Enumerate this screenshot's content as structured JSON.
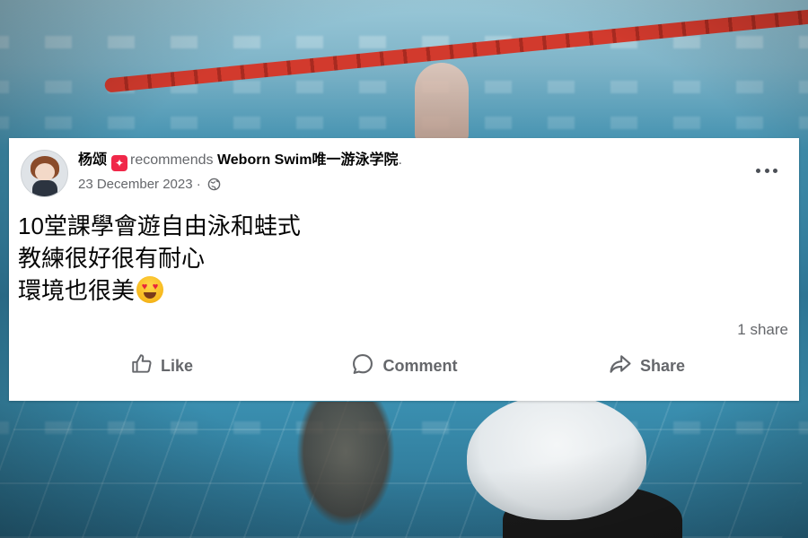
{
  "post": {
    "author": "杨颂",
    "recommend_verb": "recommends",
    "page_name": "Weborn Swim唯一游泳学院",
    "page_name_suffix": ".",
    "date": "23 December 2023",
    "separator": "·",
    "visibility_icon": "globe-icon",
    "text_lines": [
      "10堂課學會遊自由泳和蛙式",
      "教練很好很有耐心",
      "環境也很美"
    ],
    "emoji": "heart-eyes-emoji",
    "share_count": "1 share"
  },
  "actions": {
    "like_label": "Like",
    "comment_label": "Comment",
    "share_label": "Share"
  },
  "colors": {
    "card_bg": "#ffffff",
    "text_primary": "#050505",
    "text_secondary": "#65676b",
    "recommend_badge": "#f02849",
    "lane_rope": "#d23a2d"
  }
}
